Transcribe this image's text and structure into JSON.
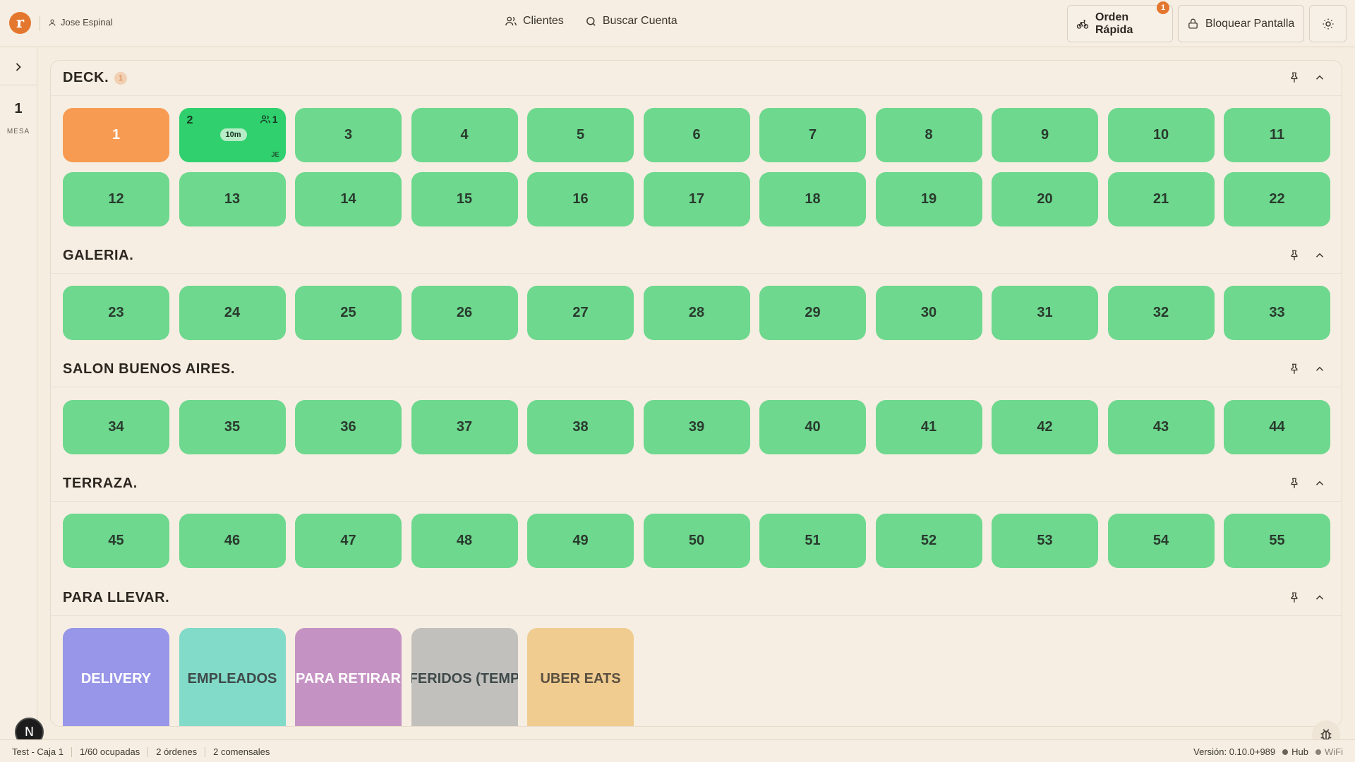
{
  "header": {
    "logo_letter": "r",
    "user_name": "Jose Espinal",
    "nav": {
      "clientes": "Clientes",
      "buscar": "Buscar Cuenta"
    },
    "orden_rapida": {
      "label": "Orden Rápida",
      "badge": "1"
    },
    "bloquear": "Bloquear Pantalla"
  },
  "sidebar": {
    "count": "1",
    "label": "MESA"
  },
  "sections": {
    "deck": {
      "title": "DECK.",
      "badge": "1"
    },
    "galeria": {
      "title": "GALERIA."
    },
    "salon": {
      "title": "SALON BUENOS AIRES."
    },
    "terraza": {
      "title": "TERRAZA."
    },
    "llevar": {
      "title": "PARA LLEVAR."
    }
  },
  "tables": {
    "deck_row1": [
      "1",
      "2",
      "3",
      "4",
      "5",
      "6",
      "7",
      "8",
      "9",
      "10",
      "11"
    ],
    "deck_row2": [
      "12",
      "13",
      "14",
      "15",
      "16",
      "17",
      "18",
      "19",
      "20",
      "21",
      "22"
    ],
    "galeria": [
      "23",
      "24",
      "25",
      "26",
      "27",
      "28",
      "29",
      "30",
      "31",
      "32",
      "33"
    ],
    "salon": [
      "34",
      "35",
      "36",
      "37",
      "38",
      "39",
      "40",
      "41",
      "42",
      "43",
      "44"
    ],
    "terraza": [
      "45",
      "46",
      "47",
      "48",
      "49",
      "50",
      "51",
      "52",
      "53",
      "54",
      "55"
    ]
  },
  "occupied_table": {
    "number": "2",
    "guests": "1",
    "time": "10m",
    "waiter": "JE"
  },
  "selected_table": "1",
  "takeaway": [
    {
      "label": "DELIVERY",
      "color": "#9896e8"
    },
    {
      "label": "EMPLEADOS",
      "color": "#82dac8"
    },
    {
      "label": "PARA RETIRAR",
      "color": "#c593c3"
    },
    {
      "label": "FERIDOS (TEMP",
      "color": "#c2c0bd"
    },
    {
      "label": "UBER EATS",
      "color": "#f0cc90"
    }
  ],
  "colors": {
    "accent": "#e4772e",
    "table_free": "#6dd88e",
    "table_occupied": "#2fd06d",
    "table_selected": "#f89b52"
  },
  "footer": {
    "caja": "Test - Caja 1",
    "ocupadas": "1/60 ocupadas",
    "ordenes": "2 órdenes",
    "comensales": "2 comensales",
    "version": "Versión: 0.10.0+989",
    "hub": "Hub",
    "wifi": "WiFi"
  },
  "floating": {
    "n_label": "N"
  }
}
